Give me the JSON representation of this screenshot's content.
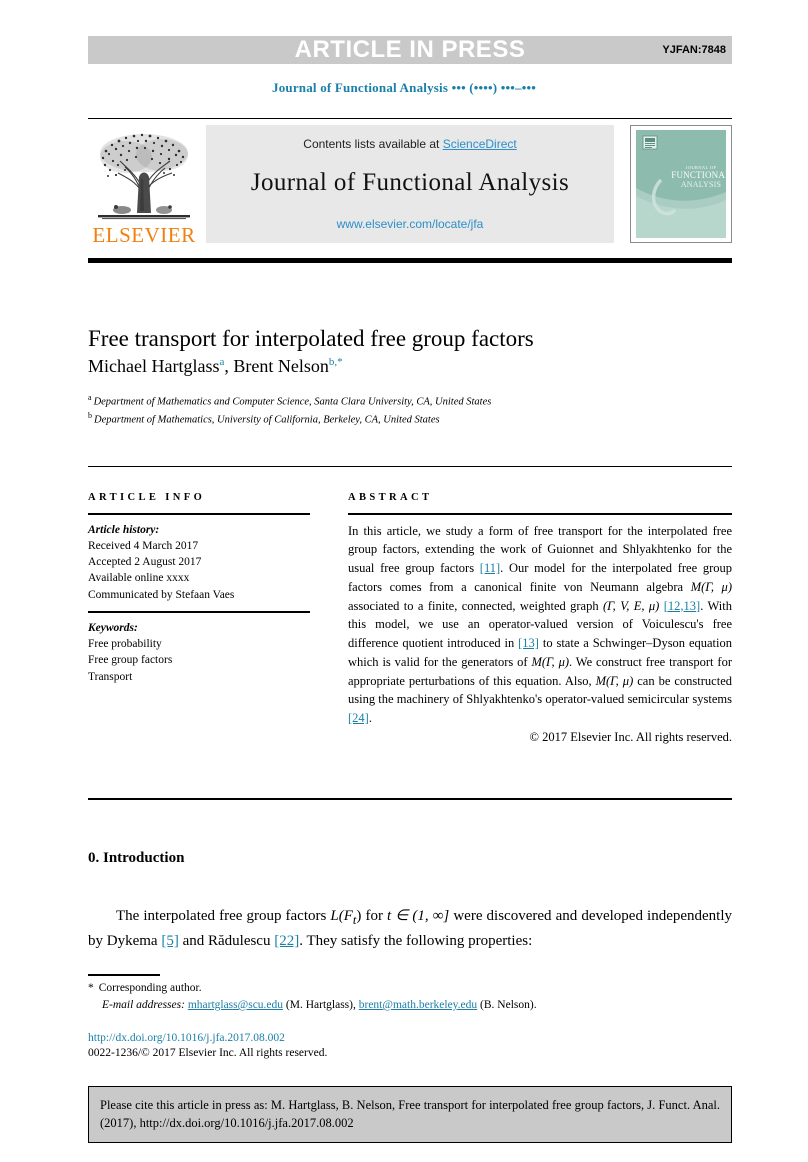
{
  "header": {
    "press_banner": "ARTICLE IN PRESS",
    "article_code": "YJFAN:7848",
    "journal_running_head": "Journal of Functional Analysis ••• (••••) •••–•••"
  },
  "masthead": {
    "contents_prefix": "Contents lists available at ",
    "sciencedirect": "ScienceDirect",
    "journal_title": "Journal of Functional Analysis",
    "journal_url": "www.elsevier.com/locate/jfa",
    "publisher_name": "ELSEVIER",
    "cover_title_line1": "JOURNAL OF",
    "cover_title_line2": "FUNCTIONAL",
    "cover_title_line3": "ANALYSIS"
  },
  "article": {
    "title": "Free transport for interpolated free group factors",
    "authors": "Michael Hartglass",
    "author1_sup": "a",
    "author2_prefix": ", Brent Nelson",
    "author2_sup": "b,*",
    "affiliation_a_mark": "a",
    "affiliation_a": "Department of Mathematics and Computer Science, Santa Clara University, CA, United States",
    "affiliation_b_mark": "b",
    "affiliation_b": "Department of Mathematics, University of California, Berkeley, CA, United States"
  },
  "info": {
    "heading": "ARTICLE INFO",
    "history_label": "Article history:",
    "received": "Received 4 March 2017",
    "accepted": "Accepted 2 August 2017",
    "available": "Available online xxxx",
    "communicated": "Communicated by Stefaan Vaes",
    "keywords_label": "Keywords:",
    "keyword1": "Free probability",
    "keyword2": "Free group factors",
    "keyword3": "Transport"
  },
  "abstract": {
    "heading": "ABSTRACT",
    "part1": "In this article, we study a form of free transport for the interpolated free group factors, extending the work of Guionnet and Shlyakhtenko for the usual free group factors ",
    "cite1": "[11]",
    "part2": ". Our model for the interpolated free group factors comes from a canonical finite von Neumann algebra ",
    "math1": "M(Γ, μ)",
    "part3": " associated to a finite, connected, weighted graph ",
    "math2": "(Γ, V, E, μ)",
    "cite2": "[12,13]",
    "part4": ". With this model, we use an operator-valued version of Voiculescu's free difference quotient introduced in ",
    "cite3": "[13]",
    "part5": " to state a Schwinger–Dyson equation which is valid for the generators of ",
    "math3": "M(Γ, μ)",
    "part6": ". We construct free transport for appropriate perturbations of this equation. Also, ",
    "math4": "M(Γ, μ)",
    "part7": " can be constructed using the machinery of Shlyakhtenko's operator-valued semicircular systems ",
    "cite4": "[24]",
    "part8": ".",
    "copyright": "© 2017 Elsevier Inc. All rights reserved."
  },
  "body": {
    "section_heading": "0. Introduction",
    "intro_part1": "The interpolated free group factors ",
    "intro_math1": "L(F",
    "intro_math1_sub": "t",
    "intro_math1_end": ")",
    "intro_part2": " for ",
    "intro_math2": "t ∈ (1, ∞]",
    "intro_part3": " were discovered and developed independently by Dykema ",
    "intro_cite1": "[5]",
    "intro_part4": " and Rădulescu ",
    "intro_cite2": "[22]",
    "intro_part5": ". They satisfy the following properties:"
  },
  "footnotes": {
    "corresponding_mark": "*",
    "corresponding": "Corresponding author.",
    "email_label": "E-mail addresses:",
    "email1": "mhartglass@scu.edu",
    "email1_name": " (M. Hartglass), ",
    "email2": "brent@math.berkeley.edu",
    "email2_name": " (B. Nelson).",
    "doi": "http://dx.doi.org/10.1016/j.jfa.2017.08.002",
    "issn": "0022-1236/© 2017 Elsevier Inc. All rights reserved."
  },
  "cite_box": {
    "text": "Please cite this article in press as: M. Hartglass, B. Nelson, Free transport for interpolated free group factors, J. Funct. Anal. (2017), http://dx.doi.org/10.1016/j.jfa.2017.08.002"
  },
  "colors": {
    "banner_gray": "#c9c9c9",
    "link_blue": "#1a7fa8",
    "sd_blue": "#2b8fc9",
    "elsevier_orange": "#f08010",
    "cover_teal": "#8dbcae"
  }
}
